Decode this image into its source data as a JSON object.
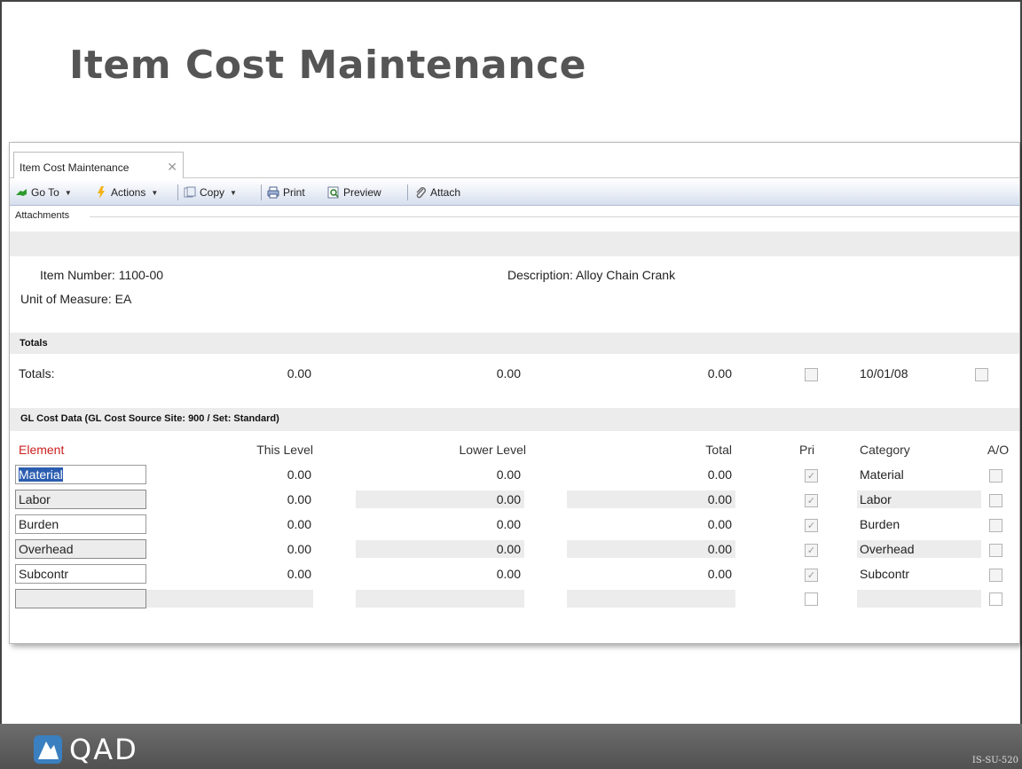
{
  "slide": {
    "title": "Item Cost Maintenance",
    "footer_logo": "QAD",
    "slide_id": "IS-SU-520"
  },
  "window": {
    "tab_label": "Item Cost Maintenance",
    "toolbar": {
      "goto_label": "Go To",
      "actions_label": "Actions",
      "copy_label": "Copy",
      "print_label": "Print",
      "preview_label": "Preview",
      "attach_label": "Attach"
    },
    "attachments_label": "Attachments"
  },
  "header_fields": {
    "item_number_label": "Item Number:",
    "item_number": "1100-00",
    "unit_of_measure_label": "Unit of Measure:",
    "unit_of_measure": "EA",
    "description_label": "Description:",
    "description": "Alloy Chain Crank"
  },
  "totals": {
    "section_title": "Totals",
    "row_label": "Totals:",
    "this_level": "0.00",
    "lower_level": "0.00",
    "total": "0.00",
    "date": "10/01/08"
  },
  "gl_cost": {
    "section_title": "GL Cost Data (GL Cost Source Site: 900 / Set: Standard)",
    "columns": {
      "element": "Element",
      "this_level": "This Level",
      "lower_level": "Lower Level",
      "total": "Total",
      "pri": "Pri",
      "category": "Category",
      "ao": "A/O"
    },
    "rows": [
      {
        "element": "Material",
        "this_level": "0.00",
        "lower_level": "0.00",
        "total": "0.00",
        "pri": true,
        "category": "Material",
        "ao": false
      },
      {
        "element": "Labor",
        "this_level": "0.00",
        "lower_level": "0.00",
        "total": "0.00",
        "pri": true,
        "category": "Labor",
        "ao": false
      },
      {
        "element": "Burden",
        "this_level": "0.00",
        "lower_level": "0.00",
        "total": "0.00",
        "pri": true,
        "category": "Burden",
        "ao": false
      },
      {
        "element": "Overhead",
        "this_level": "0.00",
        "lower_level": "0.00",
        "total": "0.00",
        "pri": true,
        "category": "Overhead",
        "ao": false
      },
      {
        "element": "Subcontr",
        "this_level": "0.00",
        "lower_level": "0.00",
        "total": "0.00",
        "pri": true,
        "category": "Subcontr",
        "ao": false
      }
    ]
  }
}
